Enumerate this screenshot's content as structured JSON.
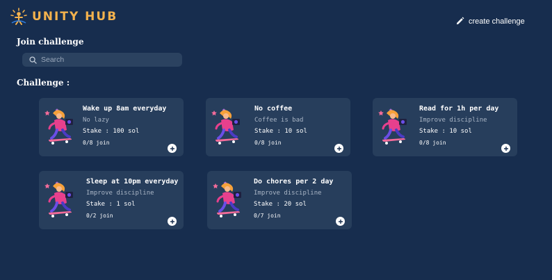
{
  "brand": {
    "name": "UNITY HUB",
    "logo_icon": "sunburst-figure-logo",
    "color": "#f4b24d"
  },
  "header": {
    "create_label": "create challenge",
    "create_icon": "pencil-icon"
  },
  "join": {
    "title": "Join challenge",
    "search_placeholder": "Search",
    "search_value": ""
  },
  "challenges": {
    "title": "Challenge :",
    "items": [
      {
        "title": "Wake up 8am everyday",
        "description": "No lazy",
        "stake": "Stake : 100 sol",
        "joined": "0/8 join"
      },
      {
        "title": "No coffee",
        "description": "Coffee is bad",
        "stake": "Stake : 10 sol",
        "joined": "0/8 join"
      },
      {
        "title": "Read for 1h per day",
        "description": "Improve discipline",
        "stake": "Stake : 10 sol",
        "joined": "0/8 join"
      },
      {
        "title": "Sleep at 10pm everyday",
        "description": "Improve discipline",
        "stake": "Stake : 1 sol",
        "joined": "0/2 join"
      },
      {
        "title": "Do chores per 2 day",
        "description": "Improve discipline",
        "stake": "Stake : 20 sol",
        "joined": "0/7 join"
      }
    ]
  },
  "colors": {
    "background": "#172d4e",
    "card": "#273e5c",
    "accent": "#f4b24d"
  }
}
